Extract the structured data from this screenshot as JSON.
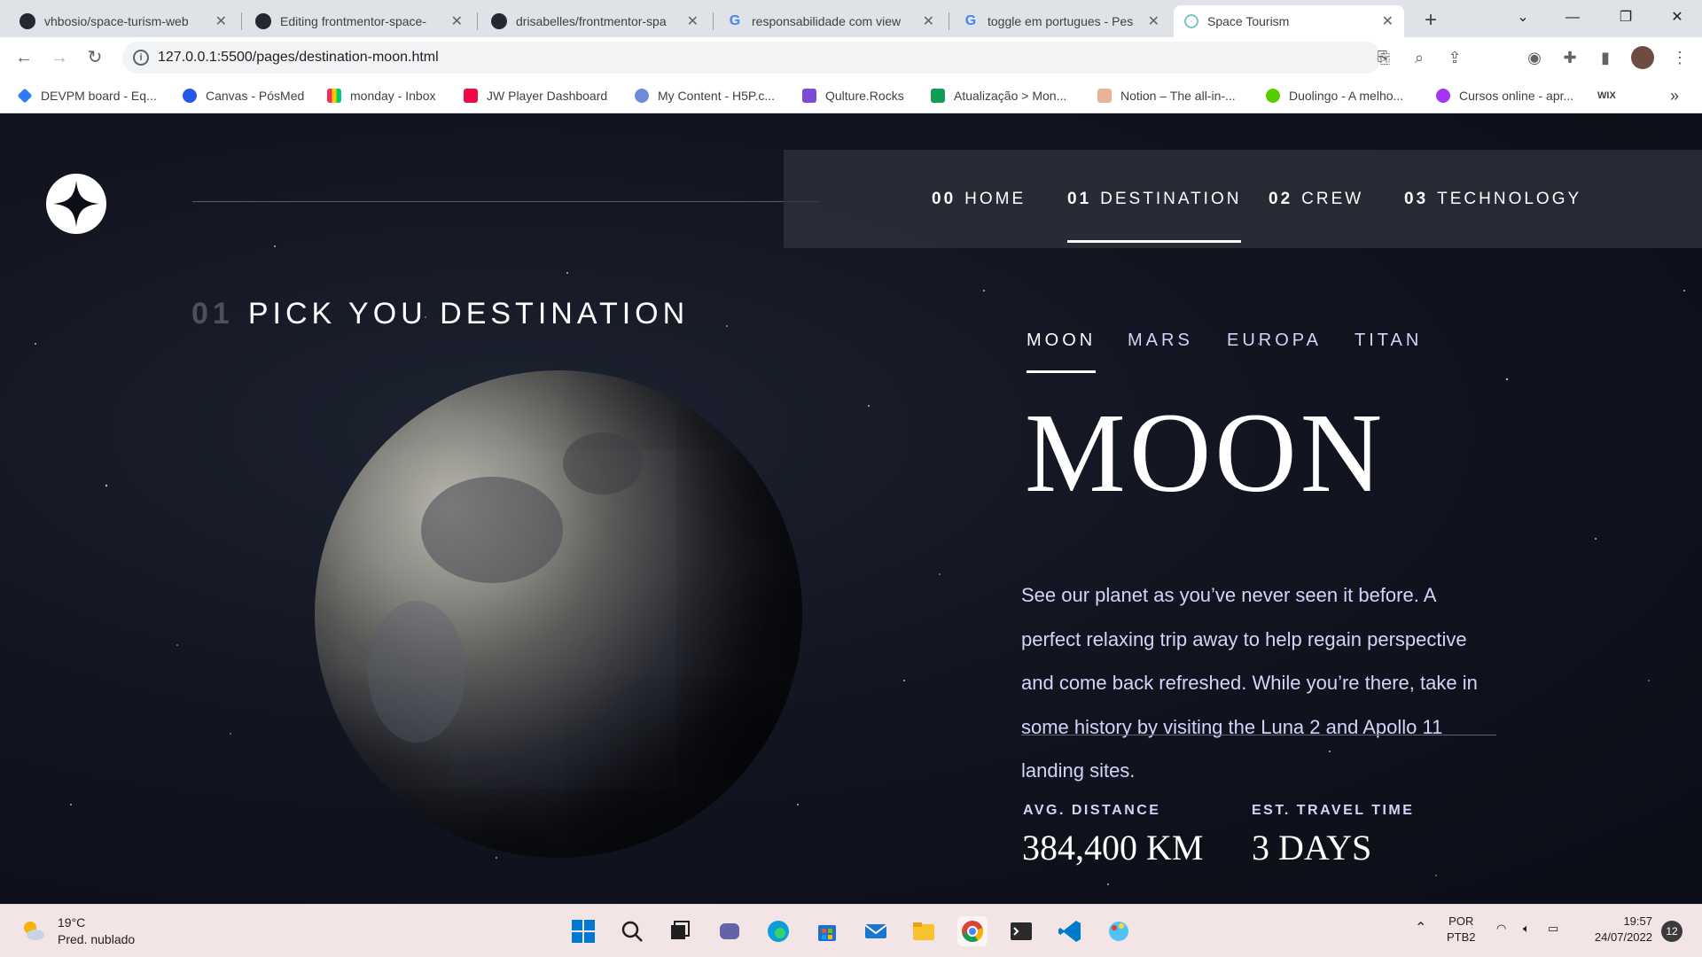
{
  "browser": {
    "tabs": [
      {
        "title": "vhbosio/space-turism-web",
        "icon": "github-icon"
      },
      {
        "title": "Editing frontmentor-space-",
        "icon": "github-icon"
      },
      {
        "title": "drisabelles/frontmentor-spa",
        "icon": "github-icon"
      },
      {
        "title": "responsabilidade com view",
        "icon": "google-icon"
      },
      {
        "title": "toggle em portugues - Pes",
        "icon": "google-icon"
      },
      {
        "title": "Space Tourism",
        "icon": "space-tourism-icon"
      }
    ],
    "url": "127.0.0.1:5500/pages/destination-moon.html",
    "bookmarks": [
      "DEVPM board - Eq...",
      "Canvas - PósMed",
      "monday - Inbox",
      "JW Player Dashboard",
      "My Content - H5P.c...",
      "Qulture.Rocks",
      "Atualização > Mon...",
      "Notion – The all-in-...",
      "Duolingo - A melho...",
      "Cursos online - apr...",
      "WIX"
    ],
    "bookmarks_overflow": "»"
  },
  "page": {
    "nav": [
      {
        "num": "00",
        "label": "HOME"
      },
      {
        "num": "01",
        "label": "DESTINATION",
        "active": true
      },
      {
        "num": "02",
        "label": "CREW"
      },
      {
        "num": "03",
        "label": "TECHNOLOGY"
      }
    ],
    "heading_num": "01",
    "heading": "PICK YOU DESTINATION",
    "destinations": [
      "MOON",
      "MARS",
      "EUROPA",
      "TITAN"
    ],
    "active_destination": "MOON",
    "name": "MOON",
    "description": "See our planet as you’ve never seen it before. A perfect relaxing trip away to help regain perspective and come back refreshed. While you’re there, take in some history by visiting the Luna 2 and Apollo 11 landing sites.",
    "distance_label": "AVG. DISTANCE",
    "distance": "384,400 KM",
    "travel_label": "EST. TRAVEL TIME",
    "travel": "3 DAYS"
  },
  "taskbar": {
    "temperature": "19°C",
    "weather": "Pred. nublado",
    "lang": "POR",
    "layout": "PTB2",
    "time": "19:57",
    "date": "24/07/2022",
    "notifications": "12"
  },
  "colors": {
    "page_bg": "#0b0d17",
    "accent_text": "#d0d6f9",
    "nav_bg": "#2e333e"
  }
}
